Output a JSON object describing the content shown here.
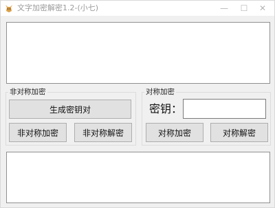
{
  "window": {
    "title": "文字加密解密1.2-(小七)",
    "minimize_glyph": "—",
    "maximize_glyph": "☐",
    "close_glyph": "✕",
    "icon": "fox-app-icon"
  },
  "input_text": {
    "value": ""
  },
  "output_text": {
    "value": ""
  },
  "asymmetric": {
    "legend": "非对称加密",
    "generate_label": "生成密钥对",
    "encrypt_label": "非对称加密",
    "decrypt_label": "非对称解密"
  },
  "symmetric": {
    "legend": "对称加密",
    "key_label": "密钥：",
    "key_value": "",
    "encrypt_label": "对称加密",
    "decrypt_label": "对称解密"
  }
}
